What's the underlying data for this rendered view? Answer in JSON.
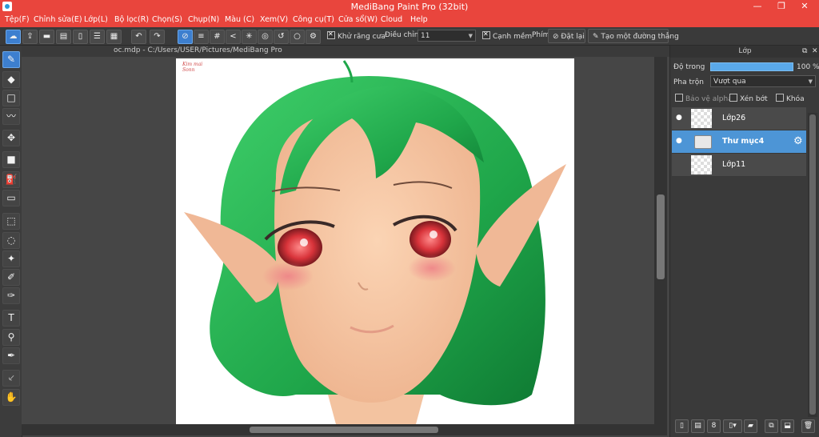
{
  "window": {
    "title": "MediBang Paint Pro (32bit)"
  },
  "menu": [
    "Tệp(F)",
    "Chỉnh sửa(E)",
    "Lớp(L)",
    "Bộ lọc(R)",
    "Chọn(S)",
    "Chụp(N)",
    "Màu (C)",
    "Xem(V)",
    "Công cụ(T)",
    "Cửa sổ(W)",
    "Cloud",
    "Help"
  ],
  "toolbar": {
    "antialias_label": "Khử răng cưa",
    "correction_label": "Điều chỉnh",
    "correction_value": "11",
    "sharp_label": "Cạnh mềm",
    "keys_label": "Phím",
    "reset_label": "Đặt lại",
    "line_label": "Tạo một đường thẳng"
  },
  "document": {
    "tab_title": "oc.mdp - C:/Users/USER/Pictures/MediBang Pro",
    "signature": "Kim mai Sonn"
  },
  "layer_panel": {
    "title": "Lớp",
    "opacity_label": "Độ trong",
    "opacity_value": "100 %",
    "opacity_fraction": 1.0,
    "blend_label": "Pha trộn",
    "blend_value": "Vượt qua",
    "protect_alpha_label": "Bảo vệ alpha",
    "clip_label": "Xén bớt",
    "lock_label": "Khóa",
    "layers": [
      {
        "name": "Lớp26",
        "visible": true,
        "selected": false,
        "type": "layer"
      },
      {
        "name": "Thư mục4",
        "visible": true,
        "selected": true,
        "type": "folder"
      },
      {
        "name": "Lớp11",
        "visible": false,
        "selected": false,
        "type": "layer"
      }
    ]
  },
  "colors": {
    "titlebar": "#e9453d",
    "accent": "#3d7fcf",
    "hair": "#1fa64a",
    "skin": "#f7c9a6"
  }
}
